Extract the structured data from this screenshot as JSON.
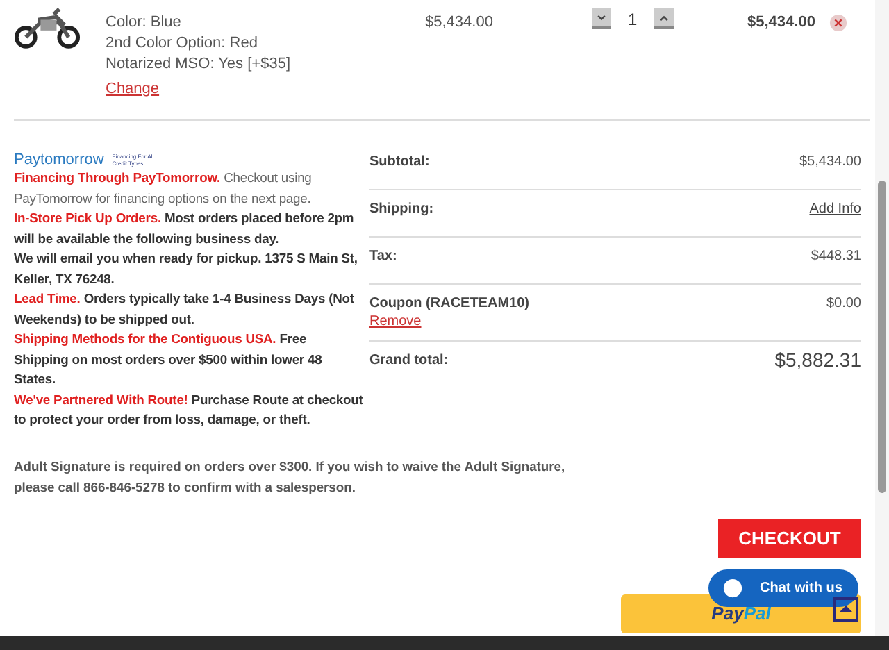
{
  "cart_item": {
    "options": [
      "Color: Blue",
      "2nd Color Option: Red",
      "Notarized MSO: Yes [+$35]"
    ],
    "change_link": "Change",
    "price": "$5,434.00",
    "quantity": "1",
    "total": "$5,434.00"
  },
  "financing_logo": {
    "brand": "Paytomorrow",
    "tagline": "Financing For All Credit Types"
  },
  "notices": [
    {
      "lead": "Financing Through PayTomorrow.",
      "text": "Checkout using PayTomorrow for financing options on the next page.",
      "bold": false
    },
    {
      "lead": "In-Store Pick Up Orders.",
      "text": "Most orders placed before 2pm will be available the following business day.",
      "bold": true
    },
    {
      "text": "We will email you when ready for pickup. 1375 S Main St, Keller, TX 76248.",
      "bold": true
    },
    {
      "lead": "Lead Time.",
      "text": "Orders typically take 1-4 Business Days (Not Weekends) to be shipped out.",
      "bold": true
    },
    {
      "lead": "Shipping Methods for the Contiguous USA.",
      "text": "Free Shipping on most orders over $500 within lower 48 States.",
      "bold": true
    },
    {
      "lead": "We've Partnered With Route!",
      "text": "Purchase Route at checkout to protect your order from loss, damage, or theft.",
      "bold": true
    }
  ],
  "summary": [
    {
      "kind": "amount",
      "label": "Subtotal:",
      "value": "$5,434.00"
    },
    {
      "kind": "link",
      "label": "Shipping:",
      "value": "Add Info"
    },
    {
      "kind": "amount",
      "label": "Tax:",
      "value": "$448.31"
    },
    {
      "kind": "coupon",
      "label": "Coupon (RACETEAM10)",
      "value": "$0.00",
      "action": "Remove"
    },
    {
      "kind": "grand",
      "label": "Grand total:",
      "value": "$5,882.31"
    }
  ],
  "signature_note": "Adult Signature is required on orders over $300. If you wish to waive the Adult Signature, please call 866-846-5278 to confirm with a salesperson.",
  "checkout_button": "CHECKOUT",
  "paypal_button": {
    "brand_a": "Pay",
    "brand_b": "Pal"
  },
  "chat_button": "Chat with us"
}
